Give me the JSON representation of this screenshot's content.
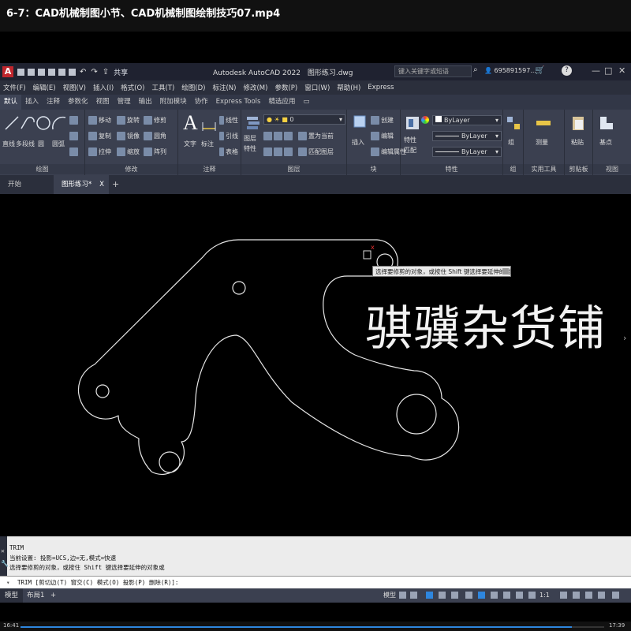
{
  "video": {
    "title": "6-7：CAD机械制图小节、CAD机械制图绘制技巧07.mp4",
    "time_current": "16:41",
    "time_total": "17:39",
    "progress": 0.945
  },
  "titlebar": {
    "logo": "A",
    "share": "共享",
    "app_title": "Autodesk AutoCAD 2022",
    "file_name": "图形练习.dwg",
    "search_placeholder": "键入关键字或短语",
    "user": "695891597...",
    "help": "?",
    "win_min": "—",
    "win_max": "□",
    "win_close": "✕"
  },
  "menubar": {
    "items": [
      "文件(F)",
      "编辑(E)",
      "视图(V)",
      "插入(I)",
      "格式(O)",
      "工具(T)",
      "绘图(D)",
      "标注(N)",
      "修改(M)",
      "参数(P)",
      "窗口(W)",
      "帮助(H)",
      "Express"
    ]
  },
  "ribbon_tabs": {
    "items": [
      "默认",
      "插入",
      "注释",
      "参数化",
      "视图",
      "管理",
      "输出",
      "附加模块",
      "协作",
      "Express Tools",
      "精选应用"
    ]
  },
  "ribbon": {
    "draw": {
      "title": "绘图",
      "line": "直线",
      "polyline": "多段线",
      "circle": "圆",
      "arc": "圆弧"
    },
    "modify": {
      "title": "修改",
      "move": "移动",
      "rotate": "旋转",
      "trim": "修剪",
      "copy": "复制",
      "mirror": "镜像",
      "fillet": "圆角",
      "stretch": "拉伸",
      "scale": "缩放",
      "array": "阵列"
    },
    "annotation": {
      "title": "注释",
      "text": "文字",
      "dimension": "标注",
      "linear": "线性",
      "leader": "引线",
      "table": "表格"
    },
    "layers": {
      "title": "图层",
      "layer_props": "图层特性",
      "current_layer": "0",
      "make_current": "置为当前",
      "match_layer": "匹配图层"
    },
    "block": {
      "title": "块",
      "insert": "插入",
      "create": "创建",
      "edit": "编辑",
      "edit_attr": "编辑属性"
    },
    "properties": {
      "title": "特性",
      "match": "特性匹配",
      "color": "ByLayer",
      "linetype": "ByLayer",
      "lineweight": "ByLayer"
    },
    "groups": {
      "title": "组",
      "group": "组"
    },
    "utilities": {
      "title": "实用工具",
      "measure": "测量"
    },
    "clipboard": {
      "title": "剪贴板",
      "paste": "粘贴"
    },
    "view": {
      "title": "视图",
      "base": "基点"
    }
  },
  "doctabs": {
    "start": "开始",
    "active": "图形练习*",
    "close": "X",
    "add": "+"
  },
  "canvas": {
    "tooltip": "选择要修剪的对象，或按住 Shift 键选择要延伸的对象或",
    "watermark": "骐骥杂货铺",
    "pick_marker": "x"
  },
  "command": {
    "lines": [
      "TRIM",
      "当前设置: 投影=UCS,边=无,模式=快速",
      "选择要修剪的对象，或按住 Shift 键选择要延伸的对象或"
    ],
    "prompt": "TRIM [剪切边(T) 窗交(C) 模式(O) 投影(P) 删除(R)]:"
  },
  "layouttabs": {
    "model": "模型",
    "layout1": "布局1",
    "add": "+"
  },
  "statusbar": {
    "model": "模型",
    "scale": "1:1"
  }
}
